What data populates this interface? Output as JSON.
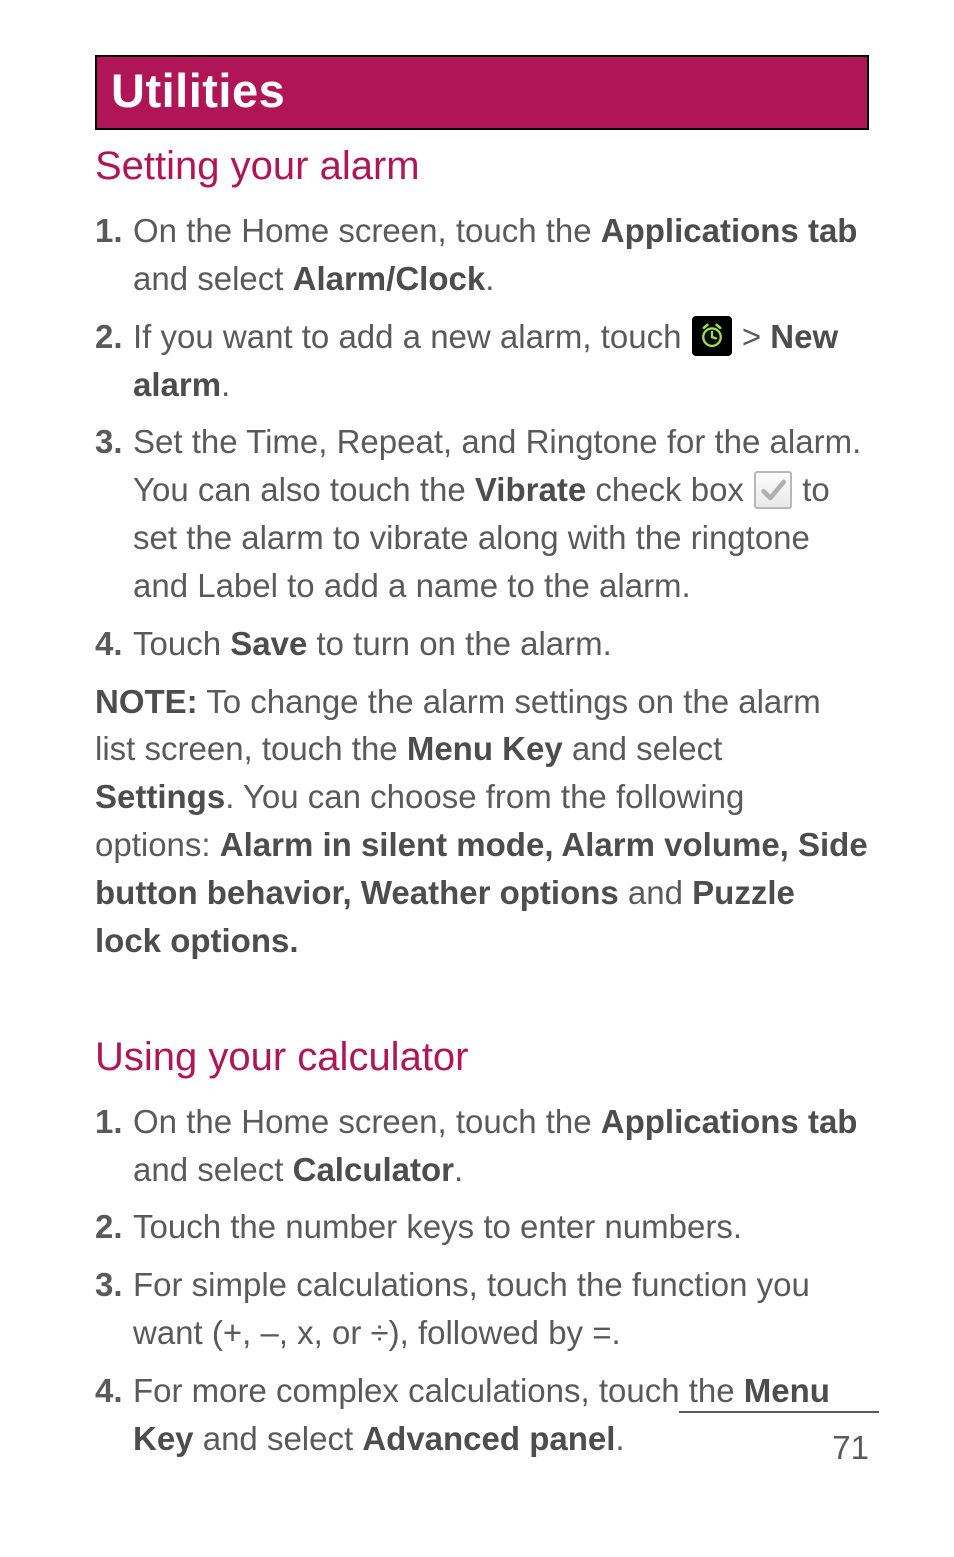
{
  "banner": {
    "title": "Utilities"
  },
  "sections": {
    "alarm": {
      "heading": "Setting your alarm",
      "steps": {
        "s1": {
          "num": "1.",
          "pre": "On the Home screen, touch the ",
          "b1": "Applications tab",
          "mid": " and select ",
          "b2": "Alarm/Clock",
          "post": "."
        },
        "s2": {
          "num": "2.",
          "pre": "If you want to add a new alarm, touch ",
          "gt": " > ",
          "b1": "New alarm",
          "post": "."
        },
        "s3": {
          "num": "3.",
          "pre": "Set the Time, Repeat, and Ringtone for the alarm. You can also touch the ",
          "b1": "Vibrate",
          "mid": " check box ",
          "post": " to set the alarm to vibrate along with the ringtone and Label to add a name to the alarm."
        },
        "s4": {
          "num": "4.",
          "pre": "Touch ",
          "b1": "Save",
          "post": " to turn on the alarm."
        }
      },
      "note": {
        "label": "NOTE:",
        "t1": " To change the alarm settings on the alarm list screen, touch the ",
        "b1": "Menu Key",
        "t2": " and select ",
        "b2": "Settings",
        "t3": ". You can choose from the following options: ",
        "b3": "Alarm in silent mode, Alarm volume, Side button behavior, Weather options",
        "t4": " and ",
        "b4": "Puzzle lock options."
      }
    },
    "calc": {
      "heading": "Using your calculator",
      "steps": {
        "s1": {
          "num": "1.",
          "pre": "On the Home screen, touch the ",
          "b1": "Applications tab",
          "mid": " and select ",
          "b2": "Calculator",
          "post": "."
        },
        "s2": {
          "num": "2.",
          "text": "Touch the number keys to enter numbers."
        },
        "s3": {
          "num": "3.",
          "text": "For simple calculations, touch the function you want (+, –, x, or ÷), followed by =."
        },
        "s4": {
          "num": "4.",
          "pre": "For more complex calculations, touch the ",
          "b1": "Menu Key",
          "mid": " and select ",
          "b2": "Advanced panel",
          "post": "."
        }
      }
    }
  },
  "page_number": "71"
}
